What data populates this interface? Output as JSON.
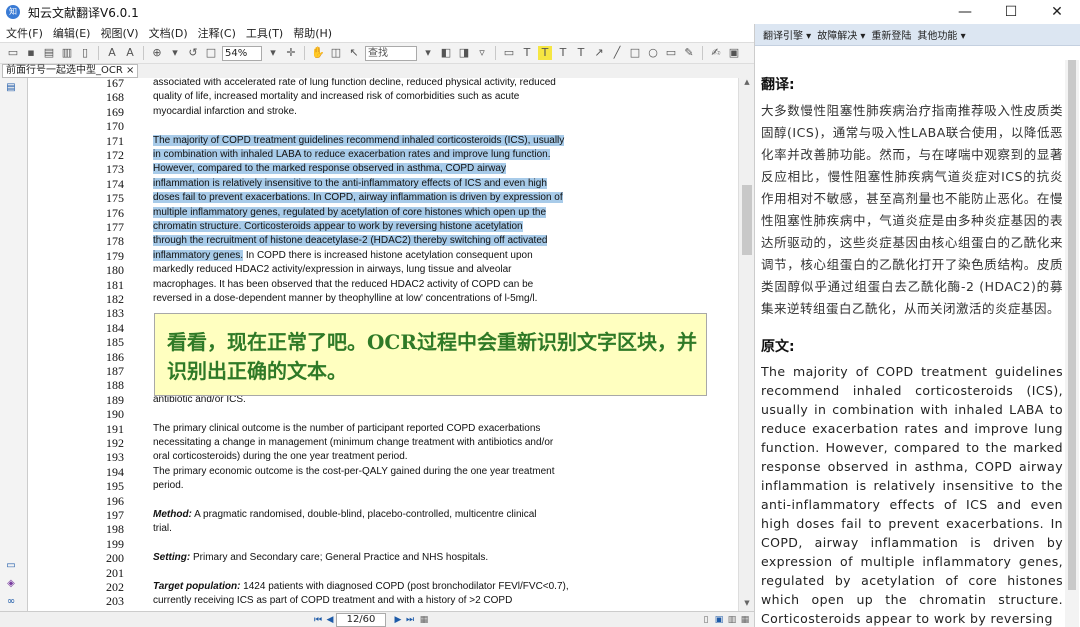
{
  "window": {
    "title": "知云文献翻译V6.0.1",
    "app_icon_text": "知云",
    "minimize": "—",
    "maximize": "☐",
    "close": "✕"
  },
  "menu": [
    "文件(F)",
    "编辑(E)",
    "视图(V)",
    "文档(D)",
    "注释(C)",
    "工具(T)",
    "帮助(H)"
  ],
  "toolbar": {
    "zoom": "54%",
    "search_placeholder": "查找"
  },
  "tab": {
    "label": "前面行号一起选中型_OCR",
    "close": "×"
  },
  "document": {
    "lines": [
      {
        "n": "167",
        "segments": [
          {
            "t": "associated with accelerated rate of lung function decline, reduced physical activity, reduced",
            "s": "n"
          }
        ]
      },
      {
        "n": "168",
        "segments": [
          {
            "t": "quality of life, increased mortality and increased risk of comorbidities such as acute",
            "s": "n"
          }
        ]
      },
      {
        "n": "169",
        "segments": [
          {
            "t": "myocardial infarction and stroke.",
            "s": "n"
          }
        ]
      },
      {
        "n": "170",
        "segments": []
      },
      {
        "n": "171",
        "segments": [
          {
            "t": "The majority of COPD treatment guidelines recommend inhaled corticosteroids (ICS), usually",
            "s": "h"
          }
        ]
      },
      {
        "n": "172",
        "segments": [
          {
            "t": "in combination with inhaled LABA to reduce exacerbation rates and improve lung function.",
            "s": "h"
          }
        ]
      },
      {
        "n": "173",
        "segments": [
          {
            "t": "However, compared to the marked response observed in asthma, COPD airway",
            "s": "h"
          }
        ]
      },
      {
        "n": "174",
        "segments": [
          {
            "t": "inflammation is relatively insensitive to the anti-inflammatory effects of ICS and even high",
            "s": "h"
          }
        ]
      },
      {
        "n": "175",
        "segments": [
          {
            "t": "doses fail to prevent exacerbations. In COPD, airway inflammation is driven by expression of",
            "s": "h"
          }
        ]
      },
      {
        "n": "176",
        "segments": [
          {
            "t": "multiple inflammatory genes, regulated by acetylation of core histones which open up the",
            "s": "h"
          }
        ]
      },
      {
        "n": "177",
        "segments": [
          {
            "t": "chromatin structure. Corticosteroids appear to work by reversing histone acetylation",
            "s": "h"
          }
        ]
      },
      {
        "n": "178",
        "segments": [
          {
            "t": "through the recruitment of histone deacetylase-2 (HDAC2) thereby switching off activated",
            "s": "h"
          }
        ]
      },
      {
        "n": "179",
        "segments": [
          {
            "t": "inflammatory genes.",
            "s": "h"
          },
          {
            "t": " In COPD there is increased histone acetylation consequent upon",
            "s": "n"
          }
        ]
      },
      {
        "n": "180",
        "segments": [
          {
            "t": "markedly reduced HDAC2 activity/expression in airways, lung tissue and alveolar",
            "s": "n"
          }
        ]
      },
      {
        "n": "181",
        "segments": [
          {
            "t": "macrophages. It has been observed that the reduced HDAC2 activity of COPD can be",
            "s": "n"
          }
        ]
      },
      {
        "n": "182",
        "segments": [
          {
            "t": "reversed in a dose-dependent manner by theophylline at low' concentrations of l-5mg/l.",
            "s": "n"
          }
        ]
      },
      {
        "n": "183",
        "segments": []
      },
      {
        "n": "184",
        "segments": []
      },
      {
        "n": "185",
        "segments": []
      },
      {
        "n": "186",
        "segments": []
      },
      {
        "n": "187",
        "segments": []
      },
      {
        "n": "188",
        "segments": []
      },
      {
        "n": "189",
        "segments": [
          {
            "t": "antibiotic and/or ICS.",
            "s": "n"
          }
        ]
      },
      {
        "n": "190",
        "segments": []
      },
      {
        "n": "191",
        "segments": [
          {
            "t": "The primary clinical outcome is the number of participant reported COPD exacerbations",
            "s": "n"
          }
        ]
      },
      {
        "n": "192",
        "segments": [
          {
            "t": "necessitating a change in management (minimum change treatment with antibiotics and/or",
            "s": "n"
          }
        ]
      },
      {
        "n": "193",
        "segments": [
          {
            "t": "oral corticosteroids) during the one year treatment period.",
            "s": "n"
          }
        ]
      },
      {
        "n": "194",
        "segments": [
          {
            "t": "The primary economic outcome is the cost-per-QALY gained during the one year treatment",
            "s": "n"
          }
        ]
      },
      {
        "n": "195",
        "segments": [
          {
            "t": "period.",
            "s": "n"
          }
        ]
      },
      {
        "n": "196",
        "segments": []
      },
      {
        "n": "197",
        "segments": [
          {
            "t": "Method:",
            "s": "b"
          },
          {
            "t": " A pragmatic randomised, double-blind, placebo-controlled, multicentre clinical",
            "s": "n"
          }
        ]
      },
      {
        "n": "198",
        "segments": [
          {
            "t": "trial.",
            "s": "n"
          }
        ]
      },
      {
        "n": "199",
        "segments": []
      },
      {
        "n": "200",
        "segments": [
          {
            "t": "Setting:",
            "s": "b"
          },
          {
            "t": " Primary and Secondary care; General Practice and NHS hospitals.",
            "s": "n"
          }
        ]
      },
      {
        "n": "201",
        "segments": []
      },
      {
        "n": "202",
        "segments": [
          {
            "t": "Target population:",
            "s": "b"
          },
          {
            "t": " 1424 patients with diagnosed COPD (post bronchodilator FEVl/FVC<0.7),",
            "s": "n"
          }
        ]
      },
      {
        "n": "203",
        "segments": [
          {
            "t": "currently receiving ICS as part of COPD treatment and with a history of >2 COPD",
            "s": "n"
          }
        ]
      }
    ]
  },
  "callout": {
    "text": "看看，现在正常了吧。OCR过程中会重新识别文字区块，并识别出正确的文本。"
  },
  "pager": {
    "page": "12/60"
  },
  "right_panel": {
    "toolbar_items": [
      "翻译引擎 ▾",
      "故障解决 ▾",
      "重新登陆",
      "其他功能 ▾"
    ],
    "translation_heading": "翻译:",
    "translation_text": "大多数慢性阻塞性肺疾病治疗指南推荐吸入性皮质类固醇(ICS)，通常与吸入性LABA联合使用，以降低恶化率并改善肺功能。然而，与在哮喘中观察到的显著反应相比，慢性阻塞性肺疾病气道炎症对ICS的抗炎作用相对不敏感，甚至高剂量也不能防止恶化。在慢性阻塞性肺疾病中，气道炎症是由多种炎症基因的表达所驱动的，这些炎症基因由核心组蛋白的乙酰化来调节，核心组蛋白的乙酰化打开了染色质结构。皮质类固醇似乎通过组蛋白去乙酰化酶-2 (HDAC2)的募集来逆转组蛋白乙酰化，从而关闭激活的炎症基因。",
    "original_heading": "原文:",
    "original_text": "The majority of COPD treatment guidelines recommend inhaled corticosteroids (ICS), usually in combination with inhaled LABA to reduce exacerbation rates and improve lung function. However, compared to the marked response observed in asthma, COPD airway inflammation is relatively insensitive to the anti-inflammatory effects of ICS and even high doses fail to prevent exacerbations. In COPD, airway inflammation is driven by expression of multiple inflammatory genes, regulated by acetylation of core histones which open up the chromatin structure. Corticosteroids appear to work by reversing"
  }
}
